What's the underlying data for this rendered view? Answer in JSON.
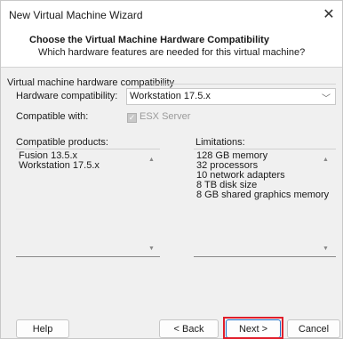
{
  "window": {
    "title": "New Virtual Machine Wizard"
  },
  "header": {
    "title": "Choose the Virtual Machine Hardware Compatibility",
    "subtitle": "Which hardware features are needed for this virtual machine?"
  },
  "group": {
    "label": "Virtual machine hardware compatibility"
  },
  "hardware_compat": {
    "label": "Hardware compatibility:",
    "value": "Workstation 17.5.x"
  },
  "compatible_with": {
    "label": "Compatible with:",
    "option": "ESX Server",
    "checked": false,
    "enabled": false
  },
  "compatible_products": {
    "label": "Compatible products:",
    "items": [
      "Fusion 13.5.x",
      "Workstation 17.5.x"
    ]
  },
  "limitations": {
    "label": "Limitations:",
    "items": [
      "128 GB memory",
      "32 processors",
      "10 network adapters",
      "8 TB disk size",
      "8 GB shared graphics memory"
    ]
  },
  "buttons": {
    "help": "Help",
    "back": "< Back",
    "next": "Next >",
    "cancel": "Cancel"
  },
  "icons": {
    "close": "close-icon",
    "dropdown": "chevron-down-icon",
    "scroll_up": "scroll-up-icon",
    "scroll_down": "scroll-down-icon"
  },
  "colors": {
    "highlight": "#e01e2b",
    "primary_border": "#1a70c8"
  }
}
